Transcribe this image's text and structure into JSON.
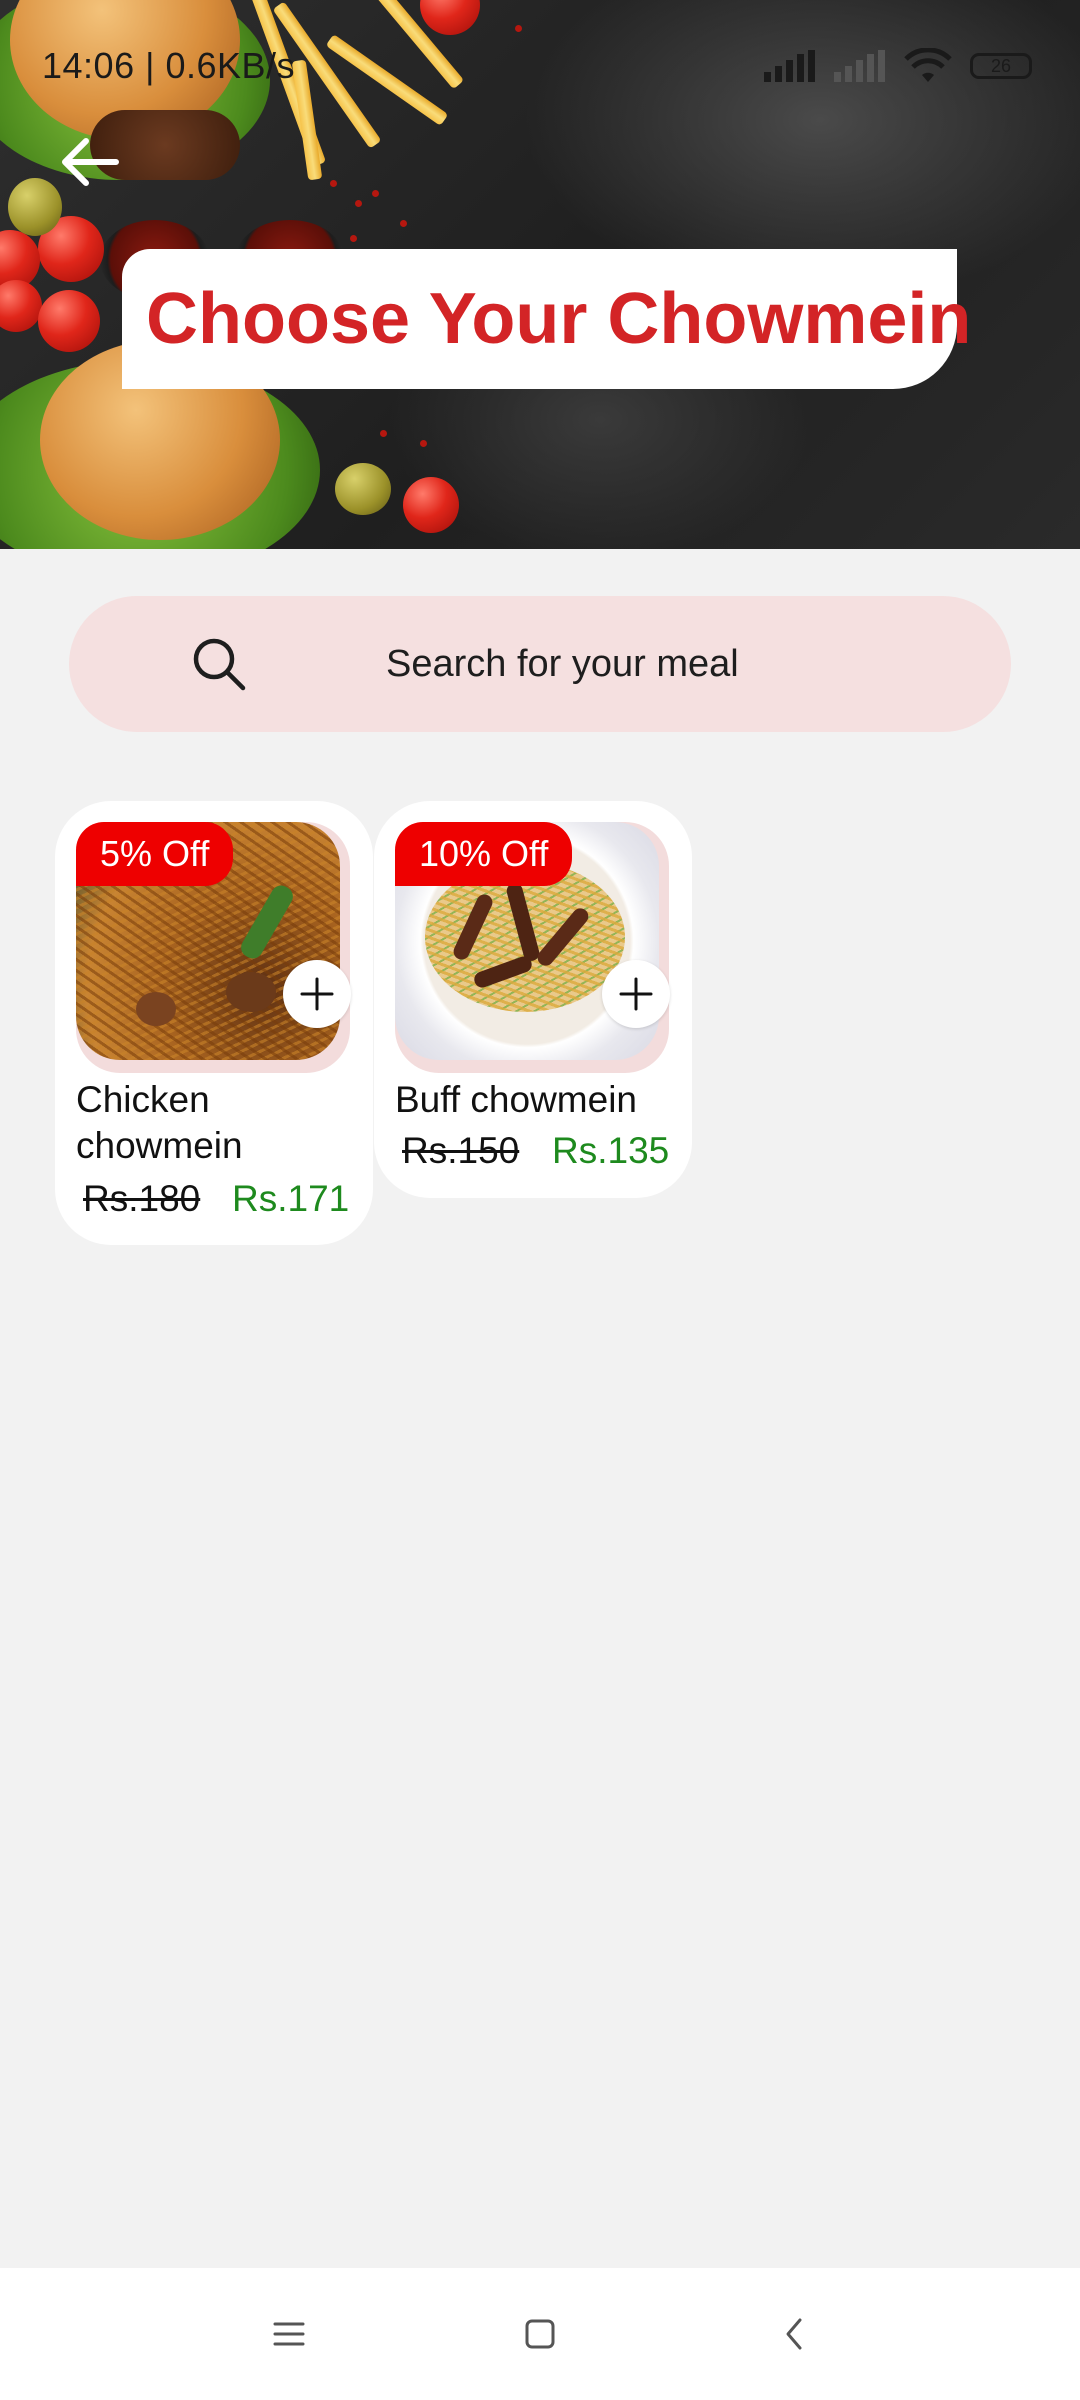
{
  "status_bar": {
    "time": "14:06 | 0.6KB/s",
    "battery": "26"
  },
  "header": {
    "title": "Choose Your Chowmein"
  },
  "search": {
    "placeholder": "Search for your meal"
  },
  "products": [
    {
      "name": "Chicken chowmein",
      "discount_badge": "5% Off",
      "old_price": "Rs.180",
      "new_price": "Rs.171"
    },
    {
      "name": "Buff chowmein",
      "discount_badge": "10% Off",
      "old_price": "Rs.150",
      "new_price": "Rs.135"
    }
  ],
  "colors": {
    "brand_red": "#d32426",
    "badge_red": "#ee0000",
    "price_green": "#1e8a1e",
    "search_bg": "#f5e0e0"
  },
  "icons": {
    "back": "arrow-left-icon",
    "search": "search-icon",
    "add": "plus-icon",
    "nav_menu": "menu-icon",
    "nav_home": "home-square-icon",
    "nav_back": "chevron-left-icon"
  }
}
